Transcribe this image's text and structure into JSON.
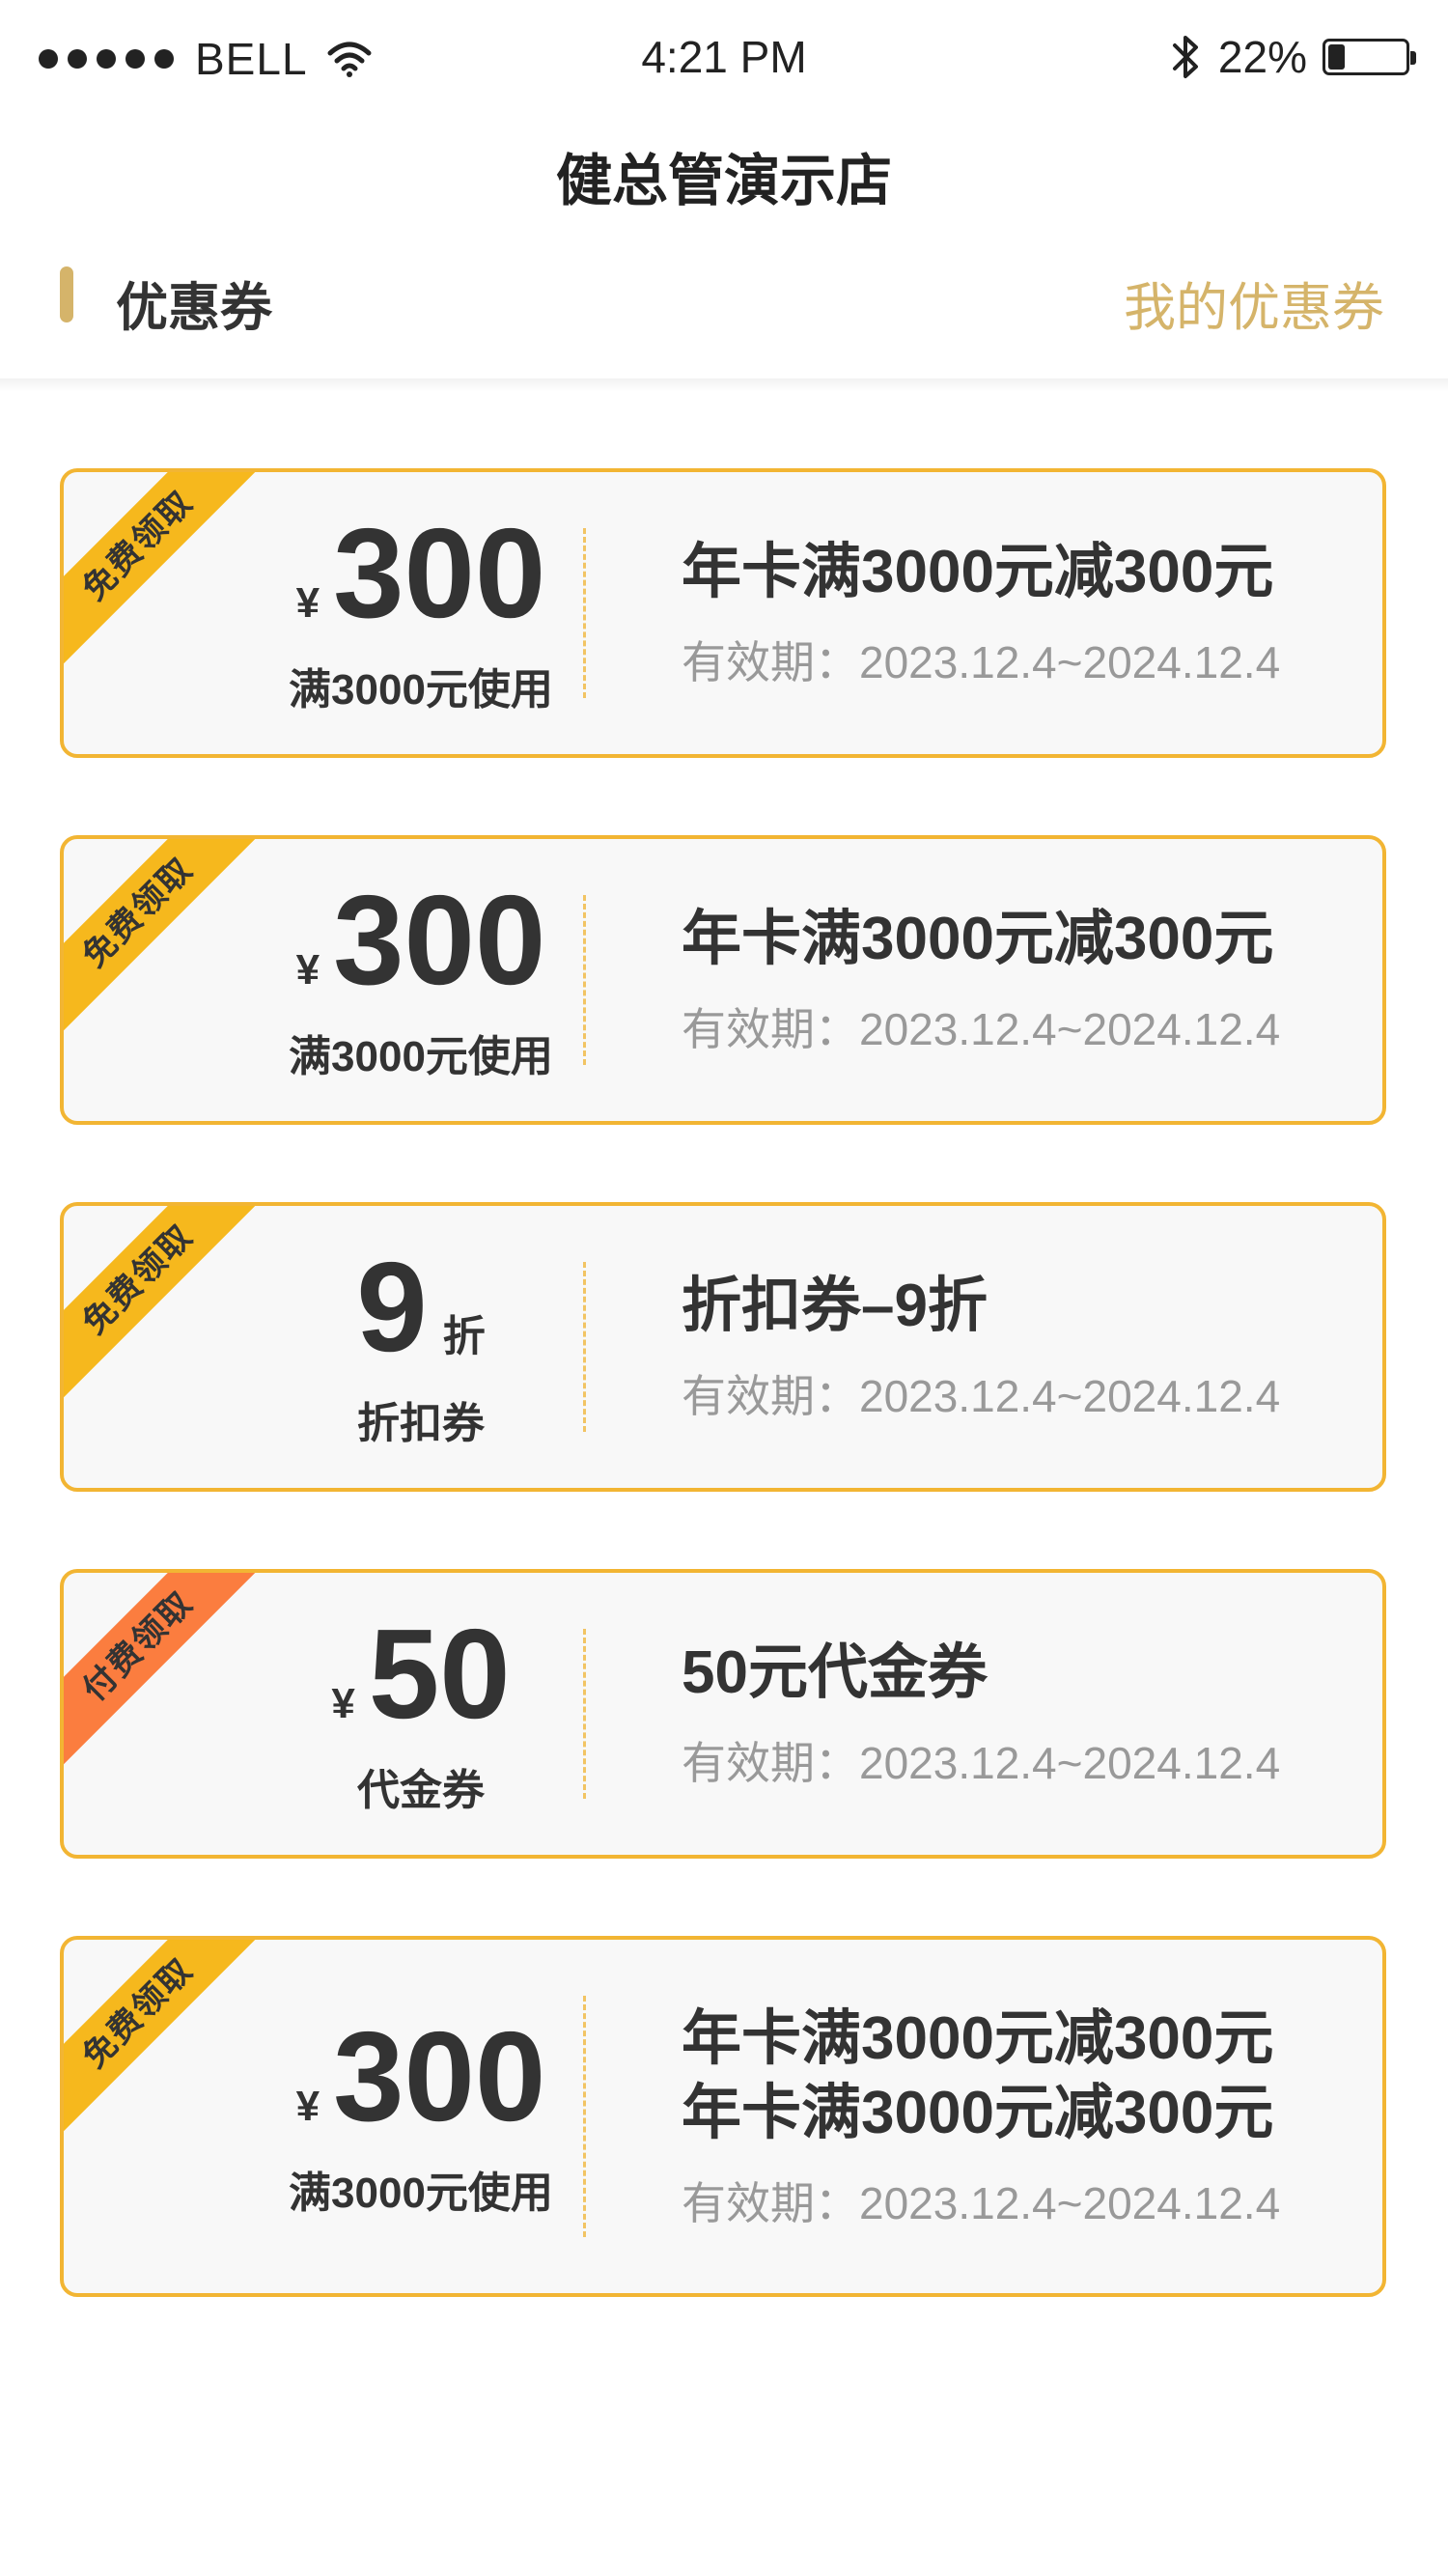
{
  "status_bar": {
    "carrier": "BELL",
    "time": "4:21 PM",
    "battery_percent": "22%",
    "battery_level": 0.22
  },
  "header": {
    "shop_name": "健总管演示店",
    "section_title": "优惠券",
    "my_coupons_link": "我的优惠券",
    "accent_color": "#d5b46a"
  },
  "coupons": [
    {
      "ribbon": "免费领取",
      "currency": "¥",
      "amount": "300",
      "unit": "",
      "condition": "满3000元使用",
      "name": "年卡满3000元减300元",
      "validity": "有效期：2023.12.4~2024.12.4"
    },
    {
      "ribbon": "免费领取",
      "currency": "¥",
      "amount": "300",
      "unit": "",
      "condition": "满3000元使用",
      "name": "年卡满3000元减300元",
      "validity": "有效期：2023.12.4~2024.12.4"
    },
    {
      "ribbon": "免费领取",
      "currency": "",
      "amount": "9",
      "unit": "折",
      "condition": "折扣券",
      "name": "折扣券–9折",
      "validity": "有效期：2023.12.4~2024.12.4"
    },
    {
      "ribbon": "付费领取",
      "currency": "¥",
      "amount": "50",
      "unit": "",
      "condition": "代金券",
      "name": "50元代金券",
      "validity": "有效期：2023.12.4~2024.12.4"
    },
    {
      "ribbon": "免费领取",
      "currency": "¥",
      "amount": "300",
      "unit": "",
      "condition": "满3000元使用",
      "name": "年卡满3000元减300元",
      "name_line2": "年卡满3000元减300元",
      "validity": "有效期：2023.12.4~2024.12.4"
    }
  ],
  "colors": {
    "free_ribbon": "#f6b81d",
    "paid_ribbon": "#fb7d3f",
    "coupon_border": "#f2b533"
  }
}
